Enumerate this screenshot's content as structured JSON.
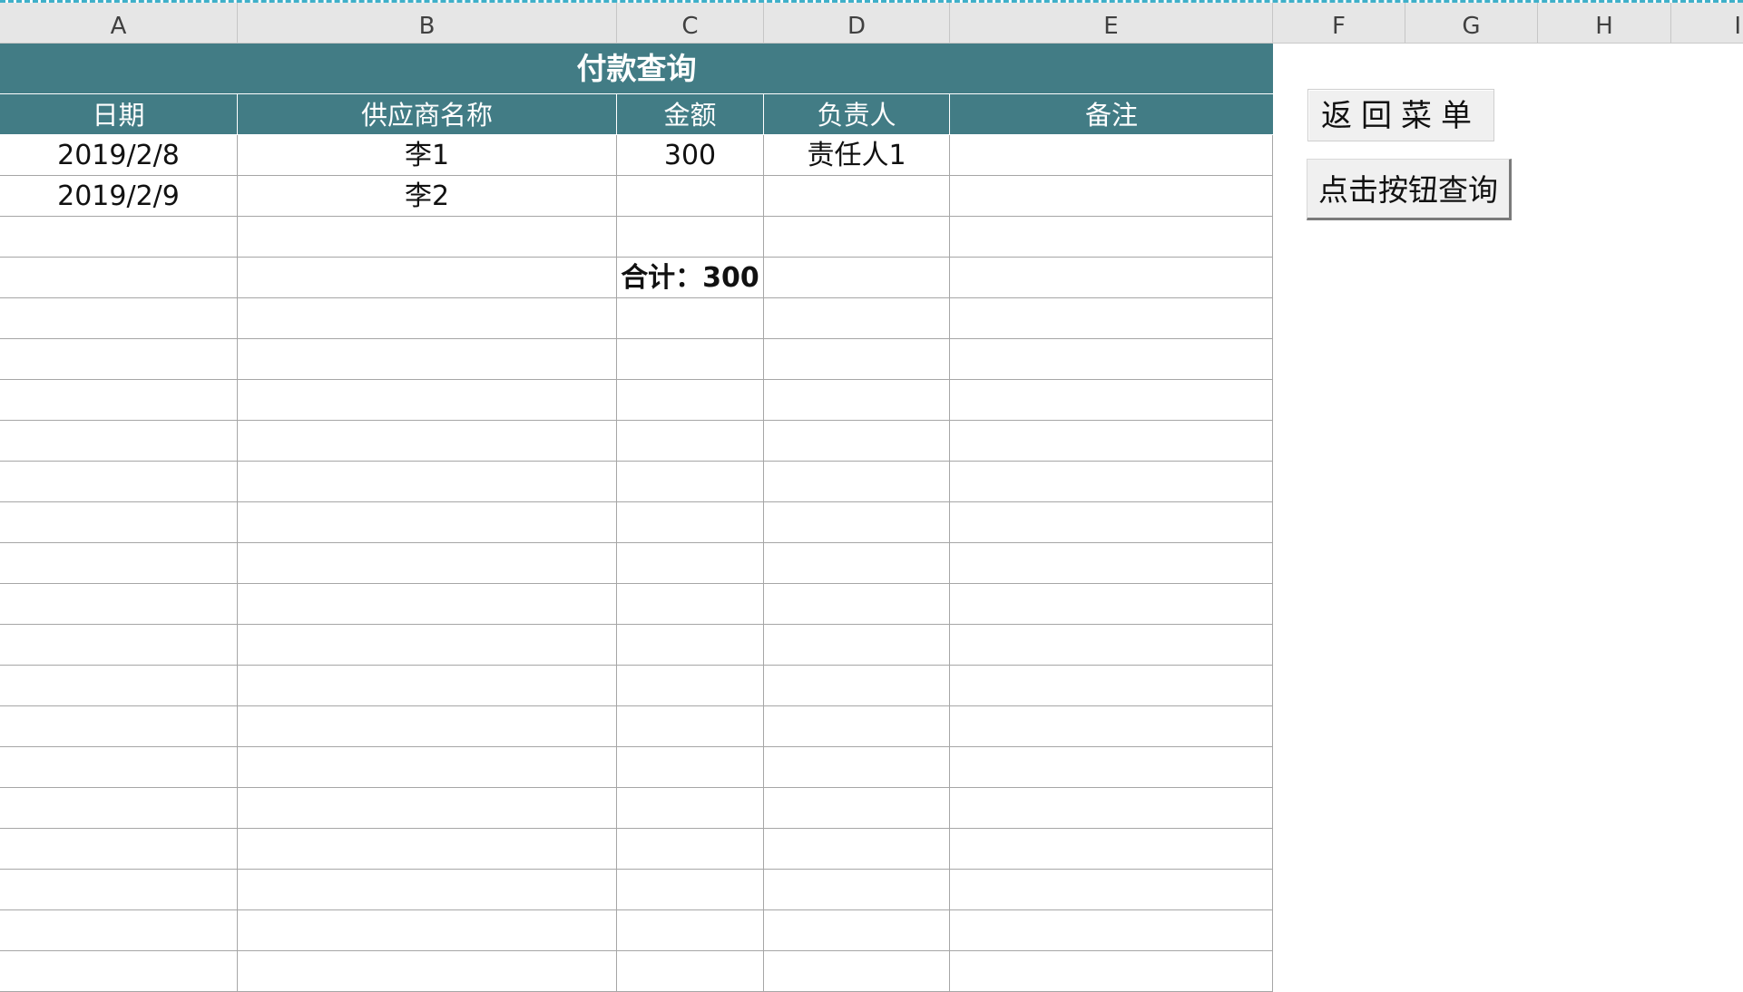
{
  "sheet": {
    "columns": [
      "A",
      "B",
      "C",
      "D",
      "E",
      "F",
      "G",
      "H",
      "I"
    ]
  },
  "report": {
    "title": "付款查询",
    "headers": [
      "日期",
      "供应商名称",
      "金额",
      "负责人",
      "备注"
    ],
    "rows": [
      [
        "2019/2/8",
        "李1",
        "300",
        "责任人1",
        ""
      ],
      [
        "2019/2/9",
        "李2",
        "",
        "",
        ""
      ],
      [
        "",
        "",
        "",
        "",
        ""
      ],
      [
        "",
        "",
        "合计：300",
        "",
        ""
      ]
    ]
  },
  "buttons": {
    "back_menu": "返回菜单",
    "query": "点击按钮查询"
  },
  "colors": {
    "header_fill": "#427c85",
    "header_text": "#ffffff",
    "grid_line": "#a6a6a6"
  }
}
